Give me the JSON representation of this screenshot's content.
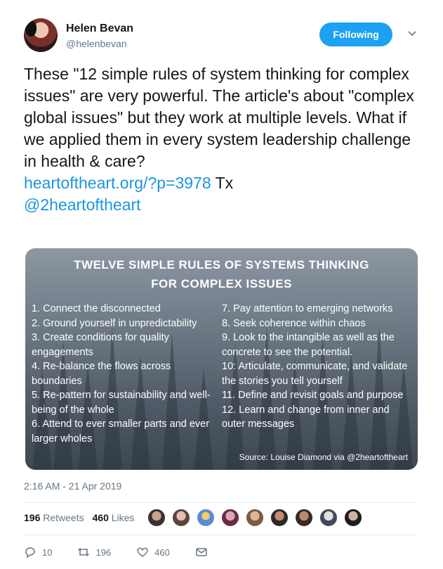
{
  "author": {
    "name": "Helen Bevan",
    "handle": "@helenbevan"
  },
  "follow_button": "Following",
  "tweet": {
    "text": "These \"12 simple rules of system thinking for complex issues\" are very powerful. The article's about \"complex global issues\" but they work at multiple levels. What if we applied them in every system leadership challenge in health & care?",
    "link": "heartoftheart.org/?p=3978",
    "after_link": "Tx",
    "mention": "@2heartoftheart"
  },
  "card": {
    "title_line1": "TWELVE SIMPLE RULES OF SYSTEMS THINKING",
    "title_line2": "FOR COMPLEX ISSUES",
    "rules_left": [
      "1. Connect the disconnected",
      "2. Ground yourself in unpredictability",
      "3. Create conditions for quality engagements",
      "4. Re-balance the flows across boundaries",
      "5. Re-pattern for sustainability and well-being of the whole",
      "6. Attend to ever smaller parts and ever larger wholes"
    ],
    "rules_right": [
      "7. Pay attention to emerging networks",
      "8. Seek coherence within chaos",
      "9. Look to the intangible as well as the concrete to see the potential.",
      "10: Articulate, communicate, and validate the stories you tell yourself",
      "11. Define and revisit goals and purpose",
      "12. Learn and change from inner and outer messages"
    ],
    "source": "Source: Louise Diamond via @2heartoftheart"
  },
  "timestamp": "2:16 AM - 21 Apr 2019",
  "stats": {
    "retweets_count": "196",
    "retweets_label": "Retweets",
    "likes_count": "460",
    "likes_label": "Likes"
  },
  "actions": {
    "reply": "10",
    "retweet": "196",
    "like": "460"
  },
  "colors": {
    "accent": "#1da1f2",
    "link": "#1b95e0",
    "text": "#14171a",
    "muted": "#657786"
  }
}
